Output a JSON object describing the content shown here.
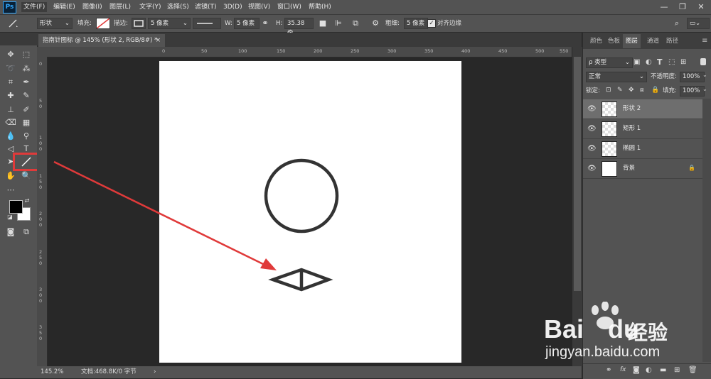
{
  "app": {
    "logo": "Ps"
  },
  "menu": {
    "items": [
      "文件(F)",
      "编辑(E)",
      "图像(I)",
      "图层(L)",
      "文字(Y)",
      "选择(S)",
      "滤镜(T)",
      "3D(D)",
      "视图(V)",
      "窗口(W)",
      "帮助(H)"
    ],
    "active_index": 0
  },
  "window_controls": {
    "minimize": "—",
    "restore": "❐",
    "close": "✕"
  },
  "options": {
    "mode": "形状",
    "fill_label": "填充:",
    "stroke_label": "描边:",
    "stroke_width": "5 像素",
    "w_label": "W:",
    "w_value": "5 像素",
    "h_label": "H:",
    "h_value": "35.38 像",
    "weight_label": "粗细:",
    "weight_value": "5 像素",
    "align_edges_label": "对齐边缘",
    "align_edges_checked": true
  },
  "document_tab": {
    "title": "指南针图标 @ 145% (形状 2, RGB/8#) *",
    "close": "×"
  },
  "rulers": {
    "top": [
      "0",
      "50",
      "100",
      "150",
      "200",
      "250",
      "300",
      "350",
      "400",
      "450",
      "500",
      "550"
    ],
    "left": [
      "0",
      "5 0",
      "1 0 0",
      "1 5 0",
      "2 0 0",
      "2 5 0",
      "3 0 0",
      "3 5 0"
    ]
  },
  "status": {
    "zoom": "145.2%",
    "doc": "文档:468.8K/0 字节",
    "arrow": "›"
  },
  "panels": {
    "tabs": [
      "颜色",
      "色板",
      "图层",
      "通道",
      "路径"
    ],
    "active_tab": 2,
    "filter_kind": "ρ 类型",
    "blend_mode": "正常",
    "opacity_label": "不透明度:",
    "opacity_value": "100%",
    "lock_label": "锁定:",
    "fill_label": "填充:",
    "fill_value": "100%"
  },
  "layers": [
    {
      "name": "形状 2",
      "selected": true,
      "thumb": "checker",
      "locked": false
    },
    {
      "name": "矩形 1",
      "selected": false,
      "thumb": "checker",
      "locked": false
    },
    {
      "name": "椭圆 1",
      "selected": false,
      "thumb": "checker",
      "locked": false
    },
    {
      "name": "背景",
      "selected": false,
      "thumb": "white",
      "locked": true
    }
  ],
  "layers_bottom_icons": [
    "link-icon",
    "fx-icon",
    "mask-icon",
    "adjustment-icon",
    "group-icon",
    "new-layer-icon",
    "trash-icon"
  ],
  "layers_bottom_fx": "fx",
  "watermark": {
    "brand": "Bai",
    "brand2": "du",
    "jingyan": "经验",
    "url": "jingyan.baidu.com"
  },
  "colors": {
    "annotation_red": "#e03a3a",
    "ps_blue": "#31a8ff",
    "shape_stroke": "#333333"
  }
}
